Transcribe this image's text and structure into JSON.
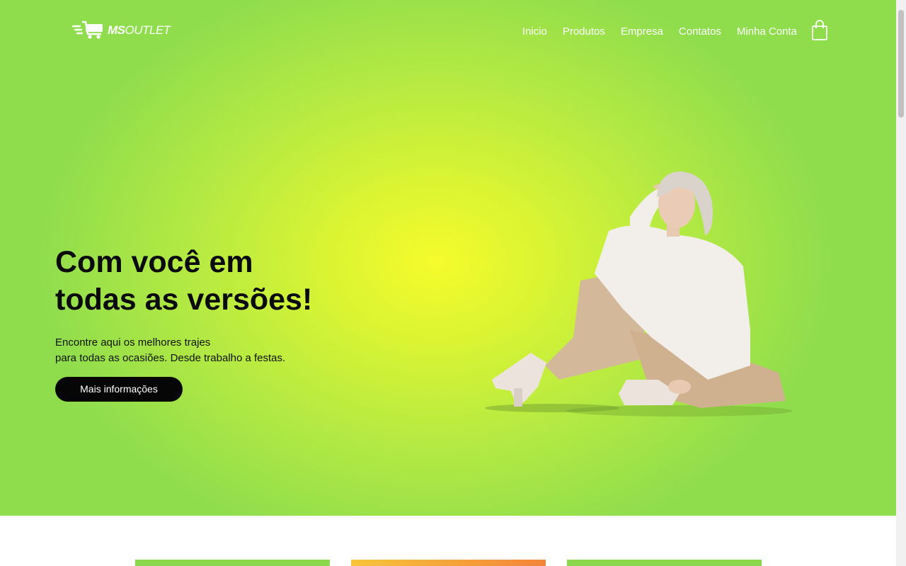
{
  "brand": {
    "logo_bold": "MS",
    "logo_light": "OUTLET"
  },
  "nav": {
    "items": [
      "Inicio",
      "Produtos",
      "Empresa",
      "Contatos",
      "Minha Conta"
    ]
  },
  "hero": {
    "headline_line1": "Com você em",
    "headline_line2": "todas as versões!",
    "subtitle_line1": "Encontre aqui os melhores trajes",
    "subtitle_line2": "para todas as ocasiões. Desde trabalho a festas.",
    "cta_label": "Mais informações"
  },
  "icons": {
    "logo": "shopping-cart-speed-icon",
    "cart": "shopping-bag-icon"
  },
  "colors": {
    "hero_center": "#f6fb2b",
    "hero_edge": "#8fdd4d",
    "cta_bg": "#060606",
    "card_green": "#8bd84e",
    "card_orange": "#f2843a"
  }
}
